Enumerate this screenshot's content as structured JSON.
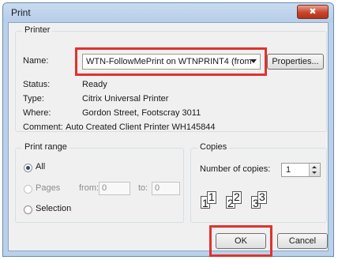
{
  "window": {
    "title": "Print",
    "close_glyph": "✖"
  },
  "printer": {
    "group_label": "Printer",
    "name_label": "Name:",
    "name_value": "WTN-FollowMePrint on WTNPRINT4 (from",
    "properties_label": "Properties...",
    "status_label": "Status:",
    "status_value": "Ready",
    "type_label": "Type:",
    "type_value": "Citrix Universal Printer",
    "where_label": "Where:",
    "where_value": "Gordon Street, Footscray 3011",
    "comment_label": "Comment:",
    "comment_value": "Auto Created Client Printer WH145844"
  },
  "print_range": {
    "group_label": "Print range",
    "all_label": "All",
    "pages_label": "Pages",
    "from_label": "from:",
    "from_value": "0",
    "to_label": "to:",
    "to_value": "0",
    "selection_label": "Selection",
    "selected": "All"
  },
  "copies": {
    "group_label": "Copies",
    "number_label": "Number of copies:",
    "number_value": "1",
    "collate_pages": [
      "1",
      "1",
      "2",
      "2",
      "3",
      "3"
    ]
  },
  "buttons": {
    "ok_label": "OK",
    "cancel_label": "Cancel"
  },
  "colors": {
    "highlight": "#e0322e",
    "title_bar": "#b9d1ea"
  },
  "icons": [
    "close-icon",
    "dropdown-arrow-icon",
    "spin-up-icon",
    "spin-down-icon",
    "collate-pages-icon"
  ]
}
